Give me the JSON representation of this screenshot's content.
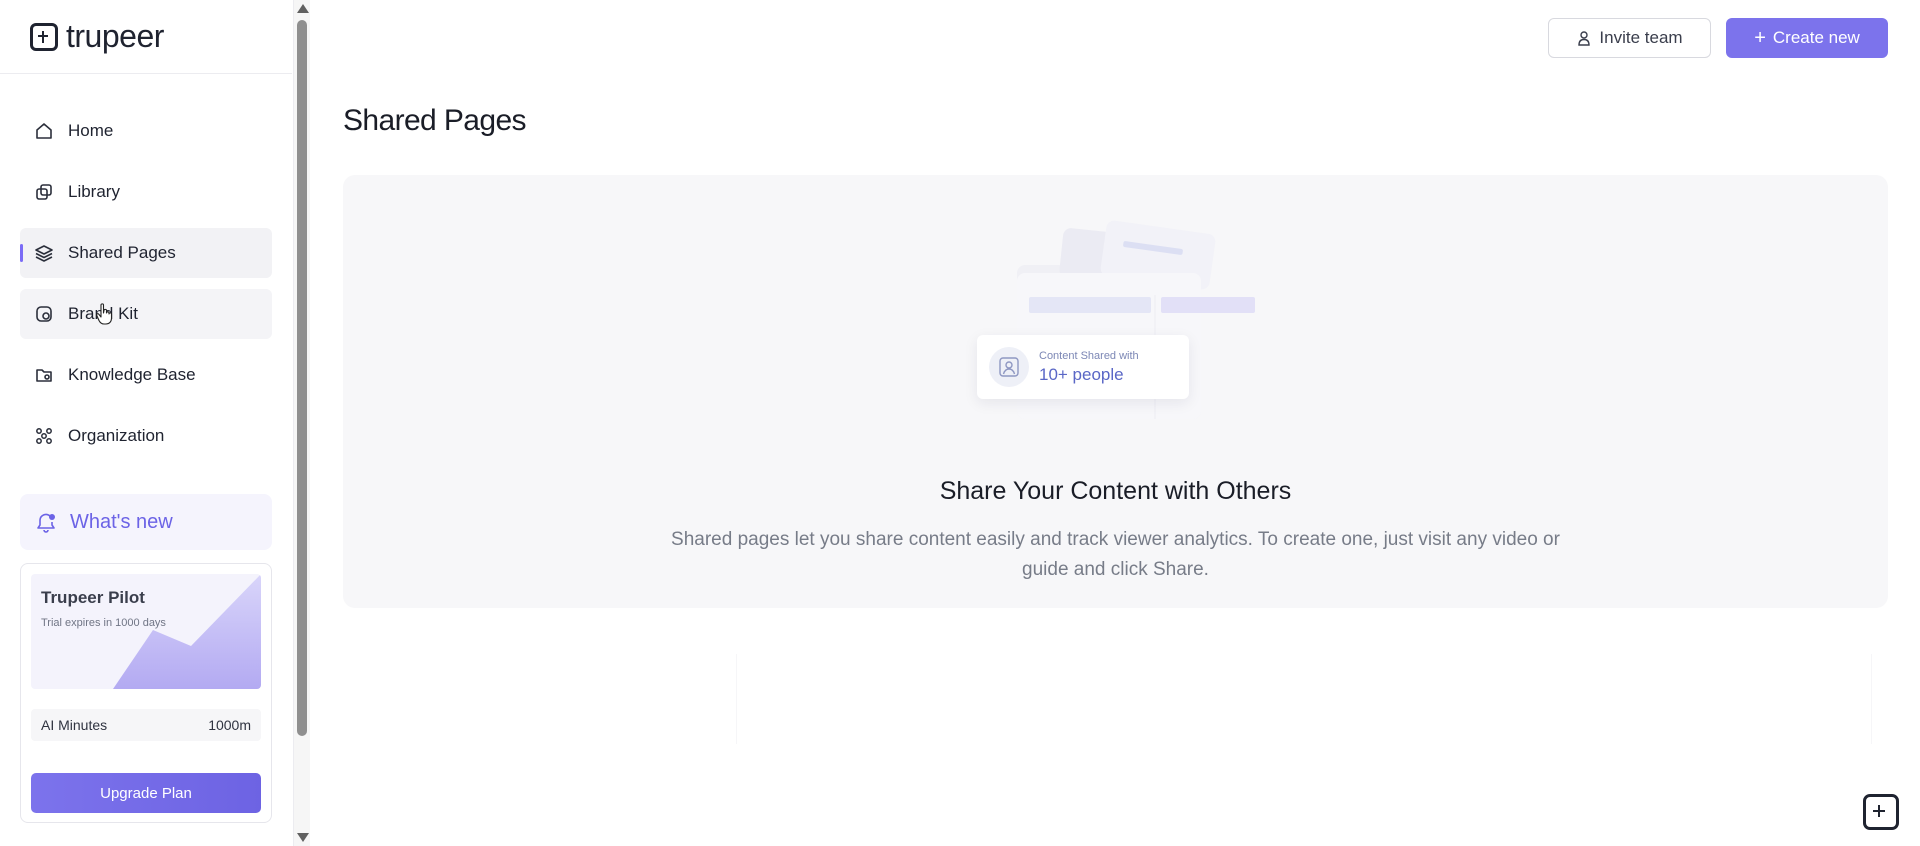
{
  "brand": {
    "name": "trupeer",
    "accent_color": "#7c73ec"
  },
  "sidebar": {
    "items": [
      {
        "label": "Home",
        "icon": "home-icon"
      },
      {
        "label": "Library",
        "icon": "library-icon"
      },
      {
        "label": "Shared Pages",
        "icon": "layers-icon",
        "active": true
      },
      {
        "label": "Brand Kit",
        "icon": "brand-kit-icon",
        "hover": true
      },
      {
        "label": "Knowledge Base",
        "icon": "folder-icon"
      },
      {
        "label": "Organization",
        "icon": "organization-icon"
      }
    ],
    "whats_new": {
      "label": "What's new",
      "icon": "bell-icon"
    },
    "plan": {
      "title": "Trupeer Pilot",
      "subtitle": "Trial expires in 1000 days",
      "minutes_label": "AI Minutes",
      "minutes_value": "1000m",
      "upgrade_label": "Upgrade Plan"
    }
  },
  "header": {
    "invite_label": "Invite team",
    "create_label": "Create new"
  },
  "main": {
    "title": "Shared Pages",
    "empty_state": {
      "card_small": "Content Shared with",
      "card_big": "10+ people",
      "title": "Share Your Content with Others",
      "description": "Shared pages let you share content easily and track viewer analytics. To create one, just visit any video or guide and click Share."
    }
  }
}
